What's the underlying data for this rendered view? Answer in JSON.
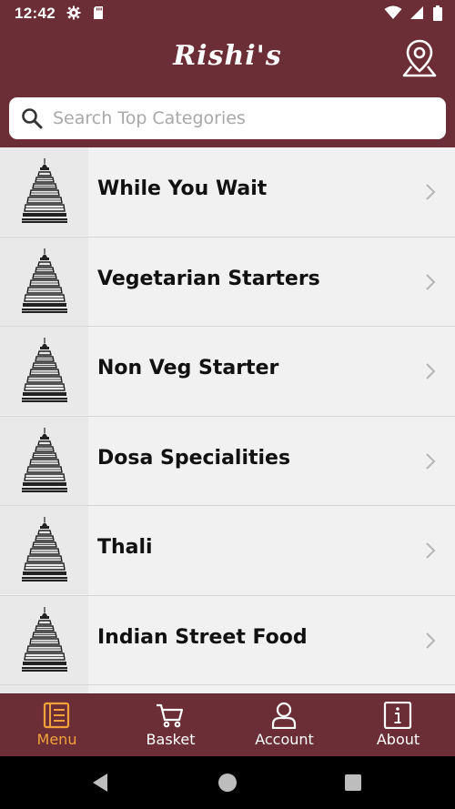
{
  "status": {
    "time": "12:42",
    "left_icons": [
      "gear-icon",
      "sd-card-icon"
    ],
    "right_icons": [
      "wifi-icon",
      "signal-icon",
      "battery-icon"
    ]
  },
  "header": {
    "title": "Rishi's",
    "location_icon": "location-pin-icon"
  },
  "search": {
    "placeholder": "Search Top Categories",
    "value": ""
  },
  "categories": [
    {
      "label": "While You Wait",
      "icon": "temple-tower-icon"
    },
    {
      "label": "Vegetarian Starters",
      "icon": "temple-tower-icon"
    },
    {
      "label": "Non Veg Starter",
      "icon": "temple-tower-icon"
    },
    {
      "label": "Dosa Specialities",
      "icon": "temple-tower-icon"
    },
    {
      "label": "Thali",
      "icon": "temple-tower-icon"
    },
    {
      "label": "Indian Street Food",
      "icon": "temple-tower-icon"
    }
  ],
  "tabs": [
    {
      "label": "Menu",
      "icon": "menu-book-icon",
      "active": true
    },
    {
      "label": "Basket",
      "icon": "cart-icon",
      "active": false
    },
    {
      "label": "Account",
      "icon": "user-icon",
      "active": false
    },
    {
      "label": "About",
      "icon": "info-icon",
      "active": false
    }
  ],
  "colors": {
    "brand": "#6b2e36",
    "active_tab": "#f2a23a",
    "list_background": "#f1f1f1"
  }
}
